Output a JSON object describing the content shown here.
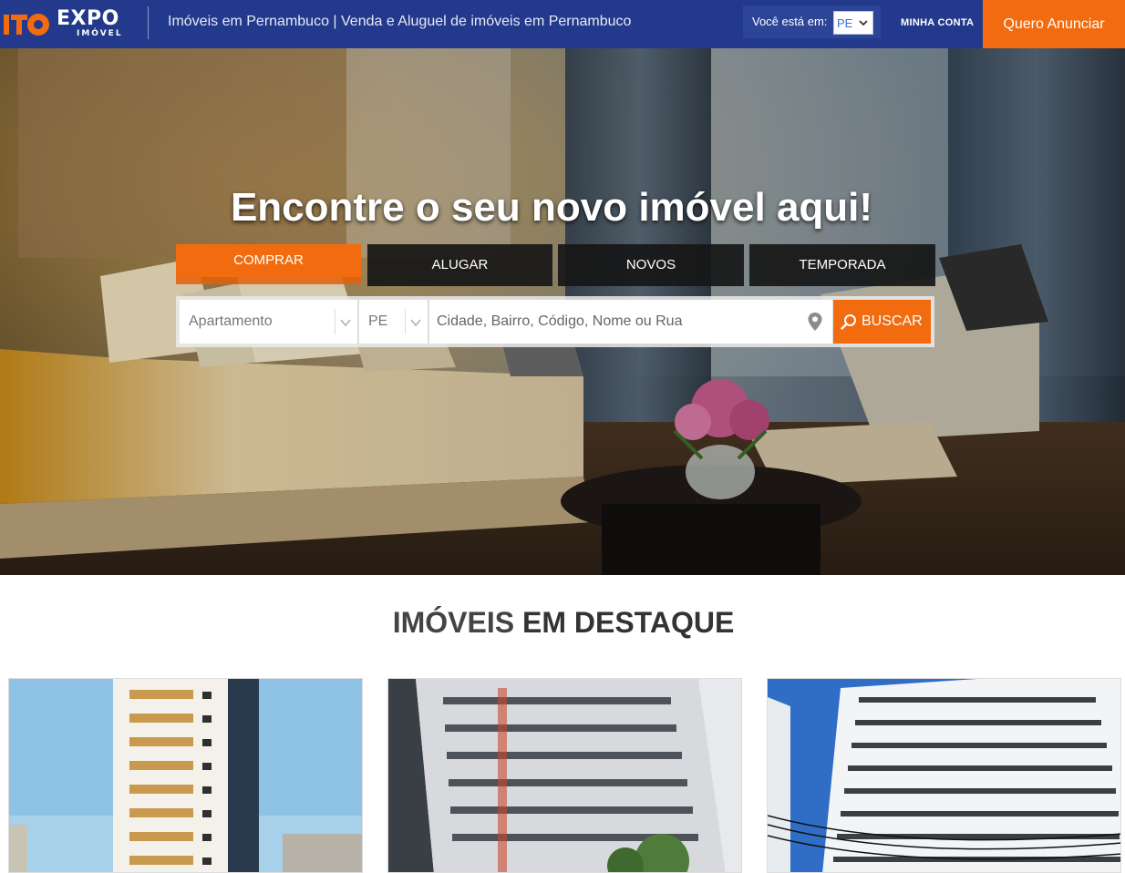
{
  "header": {
    "logo_expo": "EXPO",
    "logo_imovel": "IMÓVEL",
    "tagline": "Imóveis em Pernambuco | Venda e Aluguel de imóveis em Pernambuco",
    "location_label": "Você está em:",
    "state_selected": "PE",
    "account_link": "MINHA CONTA",
    "cta_button": "Quero Anunciar"
  },
  "hero": {
    "title": "Encontre o seu novo imóvel aqui!",
    "tabs": [
      {
        "label": "COMPRAR",
        "active": true
      },
      {
        "label": "ALUGAR",
        "active": false
      },
      {
        "label": "NOVOS",
        "active": false
      },
      {
        "label": "TEMPORADA",
        "active": false
      }
    ],
    "search": {
      "property_type": "Apartamento",
      "state": "PE",
      "query_placeholder": "Cidade, Bairro, Código, Nome ou Rua",
      "button_label": "BUSCAR"
    }
  },
  "featured": {
    "title_light": "IMÓVEIS",
    "title_bold": "EM DESTAQUE"
  },
  "colors": {
    "header_bg": "#233a8c",
    "accent_orange": "#f26b0f",
    "tab_dark": "#161616"
  },
  "icons": [
    "logo-mark-icon",
    "chevron-down-icon",
    "map-pin-icon",
    "search-icon"
  ]
}
